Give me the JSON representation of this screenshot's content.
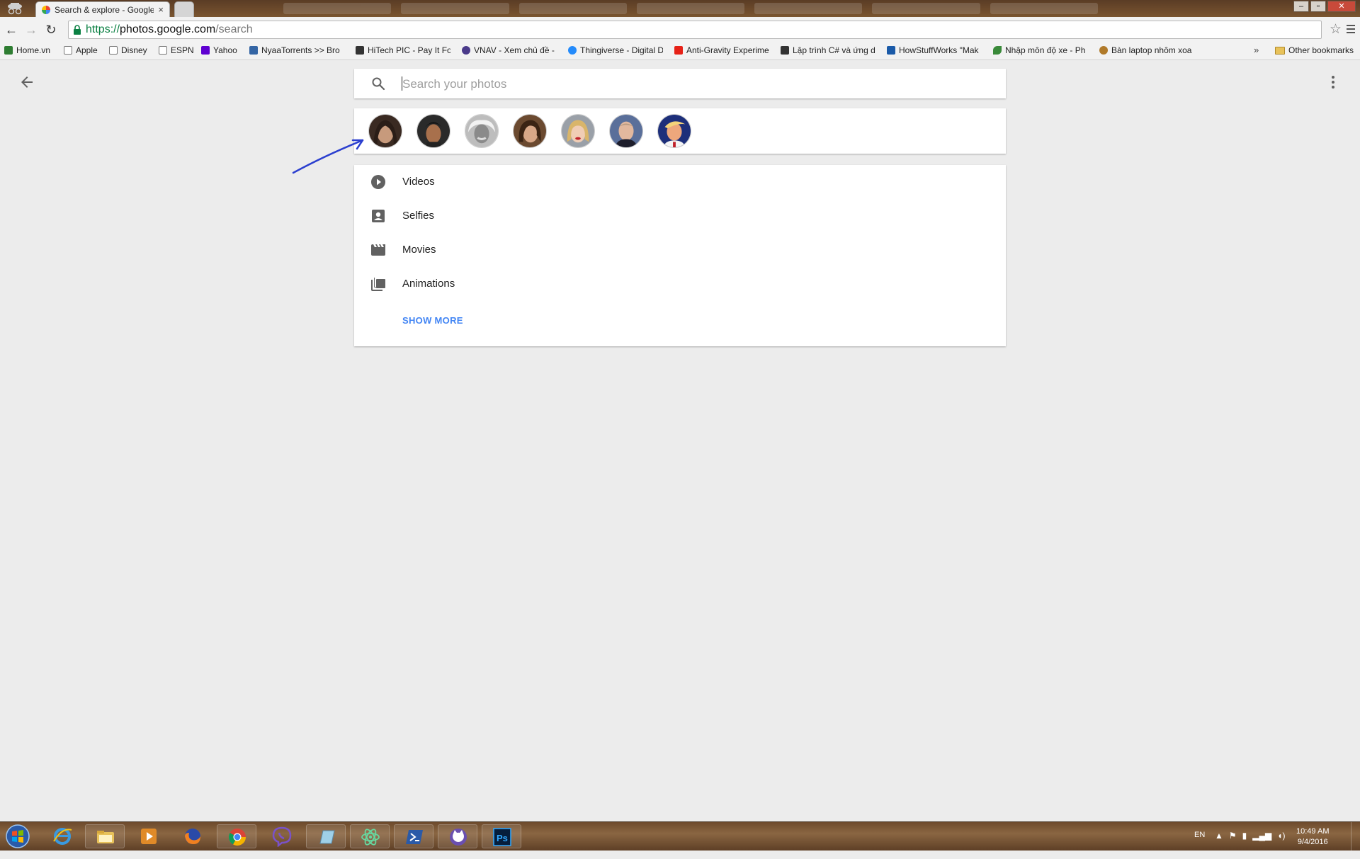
{
  "browser": {
    "active_tab": {
      "title": "Search & explore - Google Photos",
      "close_glyph": "×"
    },
    "url": {
      "scheme": "https://",
      "host": "photos.google.com",
      "path": "/search"
    },
    "bookmarks": [
      {
        "label": "Home.vn",
        "icon": "home-vn-icon",
        "color": "#2e7d32"
      },
      {
        "label": "Apple",
        "icon": "page-icon",
        "color": "#ffffff"
      },
      {
        "label": "Disney",
        "icon": "page-icon",
        "color": "#ffffff"
      },
      {
        "label": "ESPN",
        "icon": "page-icon",
        "color": "#ffffff"
      },
      {
        "label": "Yahoo",
        "icon": "yahoo-icon",
        "color": "#5f01d1"
      },
      {
        "label": "NyaaTorrents >> Bro",
        "icon": "nyaa-icon",
        "color": "#3465a4"
      },
      {
        "label": "HiTech PIC - Pay It Fo",
        "icon": "hitech-icon",
        "color": "#333333"
      },
      {
        "label": "VNAV - Xem chủ đề -",
        "icon": "vnav-icon",
        "color": "#4a3a8a"
      },
      {
        "label": "Thingiverse - Digital D",
        "icon": "thingiverse-icon",
        "color": "#248bfb"
      },
      {
        "label": "Anti-Gravity Experime",
        "icon": "youtube-icon",
        "color": "#e62117"
      },
      {
        "label": "Lập trình C# và ứng d",
        "icon": "hitech-icon",
        "color": "#333333"
      },
      {
        "label": "HowStuffWorks \"Mak",
        "icon": "hsw-icon",
        "color": "#1a5aa8"
      },
      {
        "label": "Nhập môn độ xe - Ph",
        "icon": "leaf-icon",
        "color": "#3a8a3a"
      },
      {
        "label": "Bàn laptop nhôm xoa",
        "icon": "shop-icon",
        "color": "#b07a2a"
      }
    ],
    "bookmarks_overflow": "»",
    "other_bookmarks": "Other bookmarks"
  },
  "page": {
    "search": {
      "placeholder": "Search your photos"
    },
    "people_count": 7,
    "categories": [
      {
        "label": "Videos",
        "icon": "play-circle-icon"
      },
      {
        "label": "Selfies",
        "icon": "selfie-icon"
      },
      {
        "label": "Movies",
        "icon": "movie-clapper-icon"
      },
      {
        "label": "Animations",
        "icon": "animation-stack-icon"
      }
    ],
    "show_more": "SHOW MORE",
    "annotation_color": "#2b3fcf"
  },
  "taskbar": {
    "apps": [
      "internet-explorer-icon",
      "file-explorer-icon",
      "media-player-icon",
      "firefox-icon",
      "chrome-icon",
      "viber-icon",
      "notes-icon",
      "atom-icon",
      "powershell-icon",
      "github-desktop-icon",
      "photoshop-icon"
    ],
    "language": "EN",
    "time": "10:49 AM",
    "date": "9/4/2016"
  },
  "colors": {
    "accent": "#4285f4",
    "page_bg": "#ececec",
    "icon_grey": "#616161"
  }
}
